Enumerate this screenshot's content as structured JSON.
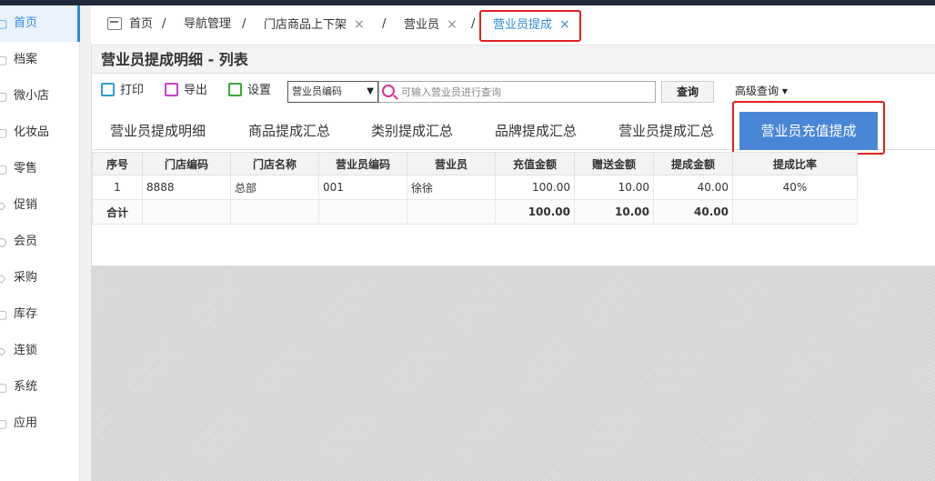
{
  "sidebar": {
    "items": [
      {
        "label": "首页",
        "icon": "home-icon"
      },
      {
        "label": "档案",
        "icon": "archive-icon"
      },
      {
        "label": "微小店",
        "icon": "shop-icon"
      },
      {
        "label": "化妆品",
        "icon": "cosmetics-icon"
      },
      {
        "label": "零售",
        "icon": "retail-icon"
      },
      {
        "label": "促销",
        "icon": "promotion-icon"
      },
      {
        "label": "会员",
        "icon": "member-icon"
      },
      {
        "label": "采购",
        "icon": "purchase-icon"
      },
      {
        "label": "库存",
        "icon": "inventory-icon"
      },
      {
        "label": "连锁",
        "icon": "chain-icon"
      },
      {
        "label": "系统",
        "icon": "system-icon"
      },
      {
        "label": "应用",
        "icon": "apps-icon"
      }
    ]
  },
  "breadcrumb": {
    "items": [
      "首页",
      "导航管理",
      "门店商品上下架",
      "营业员",
      "营业员提成"
    ],
    "close": "×",
    "sep": "/"
  },
  "panel": {
    "title": "营业员提成明细 - 列表"
  },
  "toolbar": {
    "print_label": "打印",
    "export_label": "导出",
    "settings_label": "设置",
    "select_value": "营业员编码",
    "search_placeholder": "可输入营业员进行查询",
    "query_label": "查询",
    "advanced_label": "高级查询"
  },
  "tabs": [
    "营业员提成明细",
    "商品提成汇总",
    "类别提成汇总",
    "品牌提成汇总",
    "营业员提成汇总",
    "营业员充值提成"
  ],
  "table": {
    "headers": [
      "序号",
      "门店编码",
      "门店名称",
      "营业员编码",
      "营业员",
      "充值金额",
      "赠送金额",
      "提成金额",
      "提成比率"
    ],
    "rows": [
      [
        "1",
        "8888",
        "总部",
        "001",
        "徐徐",
        "100.00",
        "10.00",
        "40.00",
        "40%"
      ]
    ],
    "total": [
      "合计",
      "",
      "",
      "",
      "",
      "100.00",
      "10.00",
      "40.00",
      ""
    ]
  },
  "colors": {
    "accent": "#2f8bd9",
    "active_tab": "#4a86d6",
    "highlight": "#e02020"
  }
}
